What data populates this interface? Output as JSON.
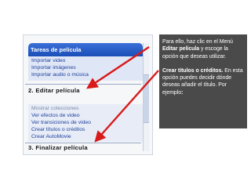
{
  "task_panel": {
    "title": "Tareas de película",
    "capture_links": [
      "Importar video",
      "Importar imágenes",
      "Importar audio o música"
    ],
    "section_edit": "2. Editar película",
    "edit_links": [
      "Mostrar colecciones",
      "Ver efectos de video",
      "Ver transiciones de video",
      "Crear títulos o créditos",
      "Crear AutoMovie"
    ],
    "section_finish": "3. Finalizar película"
  },
  "instructions": {
    "p1_before": "Para ello, haz clic en el Menú",
    "p1_bold": "Editar película",
    "p1_after": "y escoge la opción que deseas utilizar.",
    "p2_bold": "Crear títulos o créditos.",
    "p2_after": "En esta opción puedes decidir dónde deseas añadir el título. Por ejemplo",
    "p2_end": ":"
  },
  "colors": {
    "arrow": "#d81a1a",
    "panel_header": "#2a5fcf",
    "link": "#1c3f9a",
    "text_box_bg": "#4a4a4a"
  }
}
